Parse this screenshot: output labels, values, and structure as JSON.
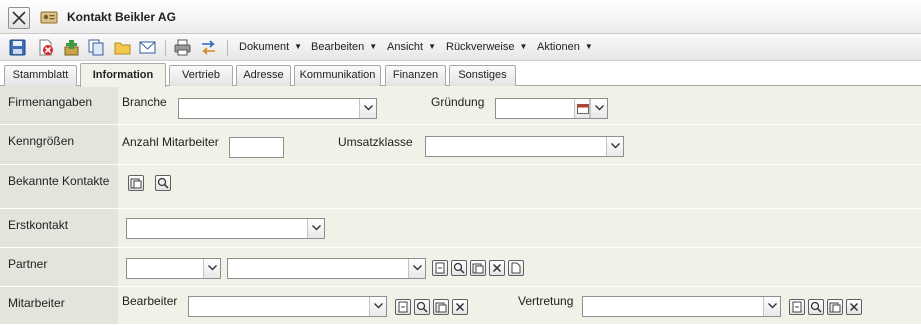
{
  "window": {
    "title": "Kontakt Beikler AG"
  },
  "toolbar": {
    "icons": [
      "save-icon",
      "delete-icon",
      "add-icon",
      "copy-icon",
      "folder-icon",
      "mail-icon",
      "print-icon",
      "transfer-icon"
    ],
    "menus": [
      {
        "label": "Dokument"
      },
      {
        "label": "Bearbeiten"
      },
      {
        "label": "Ansicht"
      },
      {
        "label": "Rückverweise"
      },
      {
        "label": "Aktionen"
      }
    ]
  },
  "tabs": [
    {
      "label": "Stammblatt"
    },
    {
      "label": "Information"
    },
    {
      "label": "Vertrieb"
    },
    {
      "label": "Adresse"
    },
    {
      "label": "Kommunikation"
    },
    {
      "label": "Finanzen"
    },
    {
      "label": "Sonstiges"
    }
  ],
  "active_tab": "Information",
  "form": {
    "firmenangaben": {
      "label": "Firmenangaben",
      "branche_label": "Branche",
      "branche_value": "",
      "gruendung_label": "Gründung",
      "gruendung_value": ""
    },
    "kenngroessen": {
      "label": "Kenngrößen",
      "mitarbeiter_label": "Anzahl Mitarbeiter",
      "mitarbeiter_value": "",
      "umsatz_label": "Umsatzklasse",
      "umsatz_value": ""
    },
    "bekannte_kontakte": {
      "label": "Bekannte Kontakte"
    },
    "erstkontakt": {
      "label": "Erstkontakt",
      "value": ""
    },
    "partner": {
      "label": "Partner",
      "type_value": "",
      "value": ""
    },
    "mitarbeiter": {
      "label": "Mitarbeiter",
      "bearbeiter_label": "Bearbeiter",
      "bearbeiter_value": "",
      "vertretung_label": "Vertretung",
      "vertretung_value": ""
    }
  },
  "colors": {
    "content_bg": "#f1f1e8",
    "label_bg": "#e4e4dd",
    "active_tab_bg": "#f2f2ea"
  }
}
